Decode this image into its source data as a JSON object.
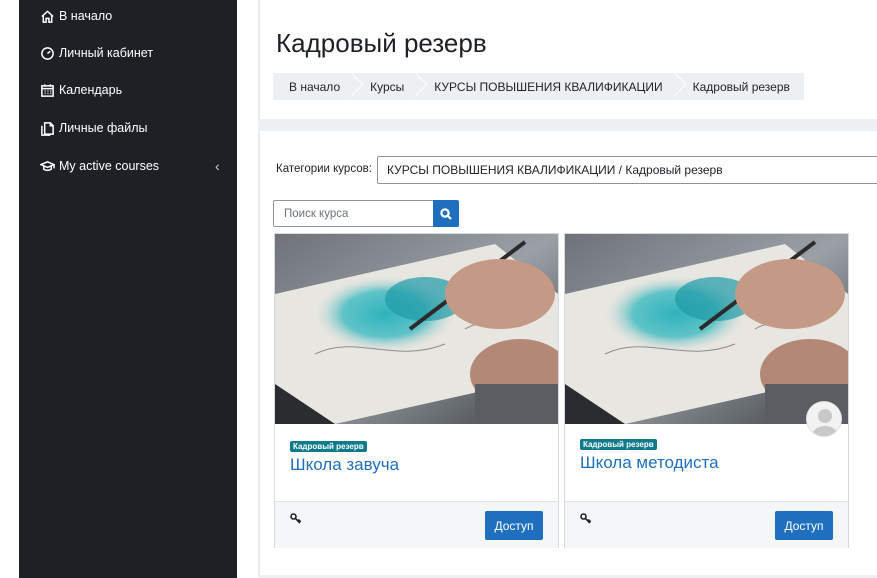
{
  "sidebar": {
    "items": [
      {
        "label": "В начало",
        "icon": "home-icon"
      },
      {
        "label": "Личный кабинет",
        "icon": "dashboard-icon"
      },
      {
        "label": "Календарь",
        "icon": "calendar-icon"
      },
      {
        "label": "Личные файлы",
        "icon": "files-icon"
      },
      {
        "label": "My active courses",
        "icon": "graduation-cap-icon"
      }
    ],
    "chevron": "‹"
  },
  "header": {
    "title": "Кадровый резерв",
    "breadcrumb": [
      "В начало",
      "Курсы",
      "КУРСЫ ПОВЫШЕНИЯ КВАЛИФИКАЦИИ",
      "Кадровый резерв"
    ]
  },
  "filters": {
    "category_label": "Категории курсов:",
    "category_value": "КУРСЫ ПОВЫШЕНИЯ КВАЛИФИКАЦИИ / Кадровый резерв",
    "search_placeholder": "Поиск курса"
  },
  "courses": [
    {
      "category": "Кадровый резерв",
      "title": "Школа завуча",
      "action": "Доступ"
    },
    {
      "category": "Кадровый резерв",
      "title": "Школа методиста",
      "action": "Доступ"
    }
  ],
  "colors": {
    "sidebar_bg": "#1d2125",
    "accent": "#1f6fbf",
    "badge": "#0e7b8c"
  }
}
